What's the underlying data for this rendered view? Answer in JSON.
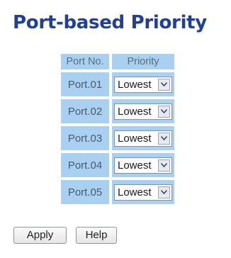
{
  "page": {
    "title": "Port-based Priority"
  },
  "table": {
    "headers": {
      "port": "Port No.",
      "priority": "Priority"
    },
    "rows": [
      {
        "port": "Port.01",
        "priority": "Lowest"
      },
      {
        "port": "Port.02",
        "priority": "Lowest"
      },
      {
        "port": "Port.03",
        "priority": "Lowest"
      },
      {
        "port": "Port.04",
        "priority": "Lowest"
      },
      {
        "port": "Port.05",
        "priority": "Lowest"
      }
    ]
  },
  "buttons": {
    "apply": "Apply",
    "help": "Help"
  },
  "icons": {
    "dropdown": "chevron-down-icon"
  },
  "colors": {
    "title": "#1f3f9c",
    "cell_background": "#a9d0f1"
  }
}
